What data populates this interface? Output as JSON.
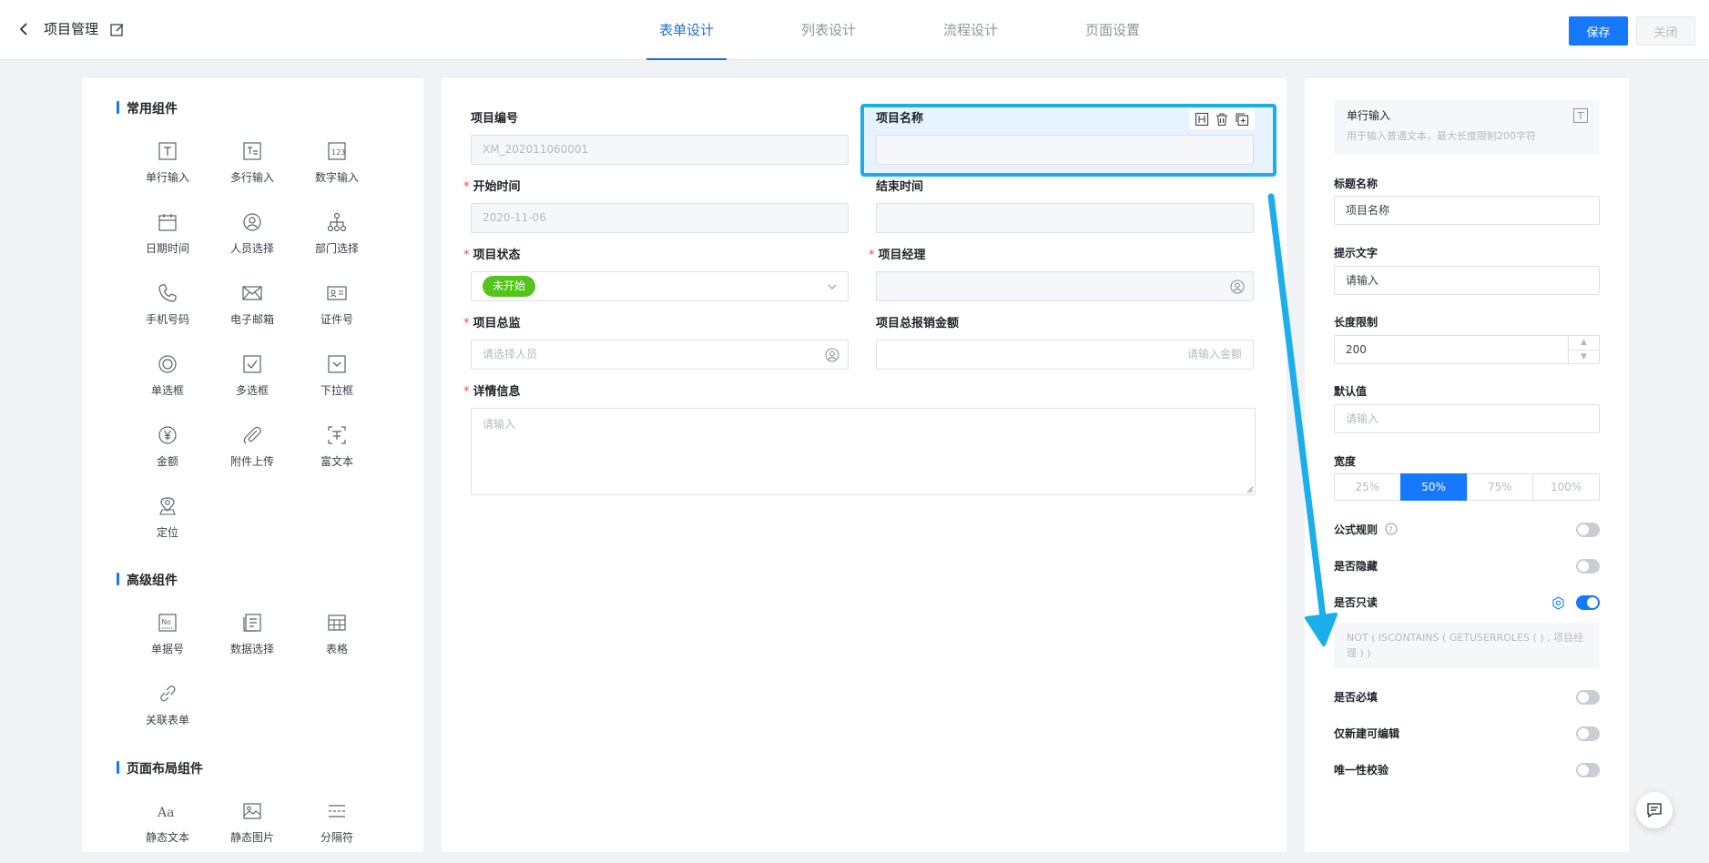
{
  "header": {
    "app_title": "项目管理",
    "tabs": [
      {
        "label": "表单设计",
        "active": true
      },
      {
        "label": "列表设计",
        "active": false
      },
      {
        "label": "流程设计",
        "active": false
      },
      {
        "label": "页面设置",
        "active": false
      }
    ],
    "save_label": "保存",
    "close_label": "关闭"
  },
  "components": {
    "common_title": "常用组件",
    "common": [
      {
        "label": "单行输入",
        "icon": "text-input-icon"
      },
      {
        "label": "多行输入",
        "icon": "textarea-icon"
      },
      {
        "label": "数字输入",
        "icon": "number-icon"
      },
      {
        "label": "日期时间",
        "icon": "calendar-icon"
      },
      {
        "label": "人员选择",
        "icon": "user-icon"
      },
      {
        "label": "部门选择",
        "icon": "org-tree-icon"
      },
      {
        "label": "手机号码",
        "icon": "phone-icon"
      },
      {
        "label": "电子邮箱",
        "icon": "mail-icon"
      },
      {
        "label": "证件号",
        "icon": "id-card-icon"
      },
      {
        "label": "单选框",
        "icon": "radio-icon"
      },
      {
        "label": "多选框",
        "icon": "checkbox-icon"
      },
      {
        "label": "下拉框",
        "icon": "dropdown-icon"
      },
      {
        "label": "金额",
        "icon": "yen-icon"
      },
      {
        "label": "附件上传",
        "icon": "paperclip-icon"
      },
      {
        "label": "富文本",
        "icon": "rich-text-icon"
      },
      {
        "label": "定位",
        "icon": "location-icon"
      }
    ],
    "advanced_title": "高级组件",
    "advanced": [
      {
        "label": "单据号",
        "icon": "serial-number-icon"
      },
      {
        "label": "数据选择",
        "icon": "data-select-icon"
      },
      {
        "label": "表格",
        "icon": "table-icon"
      },
      {
        "label": "关联表单",
        "icon": "link-icon"
      }
    ],
    "layout_title": "页面布局组件",
    "layout": [
      {
        "label": "静态文本",
        "icon": "static-text-icon"
      },
      {
        "label": "静态图片",
        "icon": "image-icon"
      },
      {
        "label": "分隔符",
        "icon": "divider-icon"
      }
    ]
  },
  "form": {
    "project_no": {
      "label": "项目编号",
      "value": "XM_202011060001"
    },
    "project_name": {
      "label": "项目名称",
      "value": ""
    },
    "start_time": {
      "label": "开始时间",
      "required": "*",
      "value": "2020-11-06"
    },
    "end_time": {
      "label": "结束时间",
      "value": ""
    },
    "status": {
      "label": "项目状态",
      "required": "*",
      "tag": "未开始",
      "tag_color": "#52c41a"
    },
    "manager": {
      "label": "项目经理",
      "required": "*",
      "value": ""
    },
    "director": {
      "label": "项目总监",
      "required": "*",
      "placeholder": "请选择人员"
    },
    "reimburse": {
      "label": "项目总报销金额",
      "placeholder": "请输入金额"
    },
    "detail": {
      "label": "详情信息",
      "required": "*",
      "placeholder": "请输入"
    }
  },
  "props": {
    "component_name": "单行输入",
    "component_desc": "用于输入普通文本，最大长度限制200字符",
    "title_label": "标题名称",
    "title_value": "项目名称",
    "hint_label": "提示文字",
    "hint_value": "请输入",
    "length_label": "长度限制",
    "length_value": "200",
    "default_label": "默认值",
    "default_placeholder": "请输入",
    "width_label": "宽度",
    "widths": [
      "25%",
      "50%",
      "75%",
      "100%"
    ],
    "selected_width": "50%",
    "formula_label": "公式规则",
    "hidden_label": "是否隐藏",
    "readonly_label": "是否只读",
    "readonly_formula": "NOT ( ISCONTAINS ( GETUSERROLES ( ) , 项目经理 ) )",
    "required_label": "是否必填",
    "new_only_label": "仅新建可编辑",
    "unique_label": "唯一性校验",
    "toggles": {
      "formula": false,
      "hidden": false,
      "readonly": true,
      "required": false,
      "new_only": false,
      "unique": false
    }
  },
  "colors": {
    "accent": "#1677ff",
    "selection_border": "#1aaeea",
    "status_green": "#52c41a"
  }
}
